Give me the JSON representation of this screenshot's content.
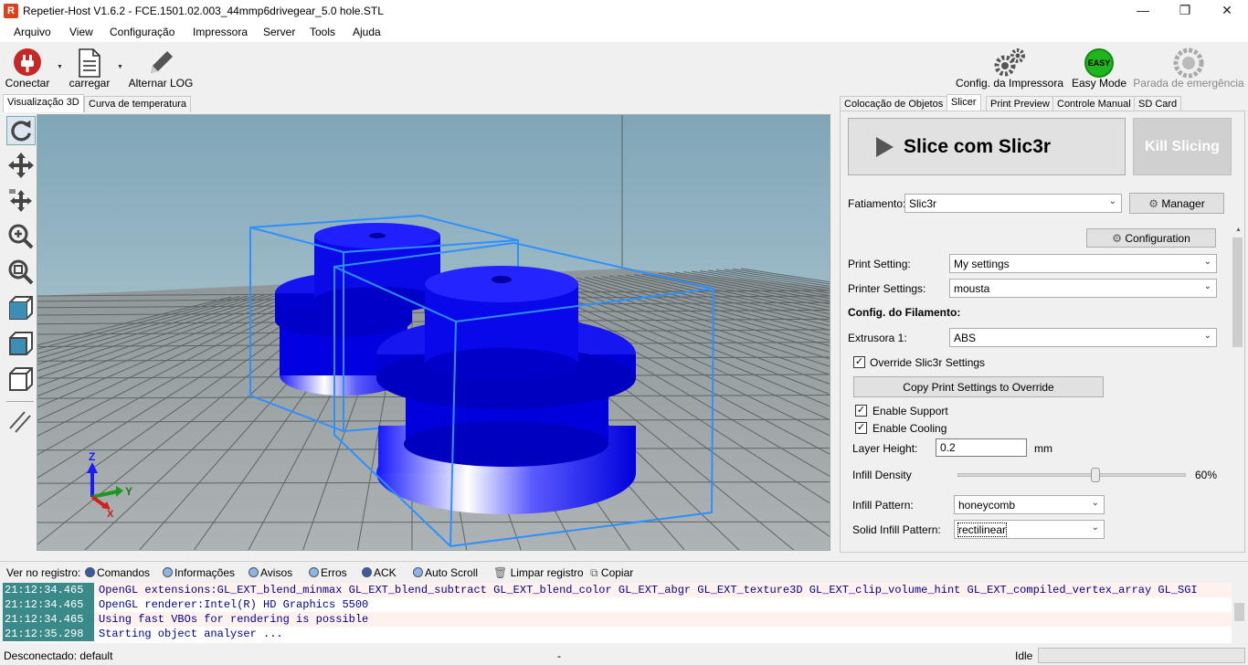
{
  "window": {
    "app_icon": "R",
    "title": "Repetier-Host V1.6.2 - FCE.1501.02.003_44mmp6drivegear_5.0 hole.STL",
    "minimize": "—",
    "maximize": "❐",
    "close": "✕"
  },
  "menu": [
    "Arquivo",
    "View",
    "Configuração",
    "Impressora",
    "Server",
    "Tools",
    "Ajuda"
  ],
  "toolbar": {
    "connect": "Conectar",
    "load": "carregar",
    "toggle_log": "Alternar LOG",
    "printer_config": "Config. da Impressora",
    "easy_mode": "Easy Mode",
    "easy_badge": "EASY",
    "emergency_stop": "Parada de emergência"
  },
  "left_tabs": [
    "Visualização 3D",
    "Curva de temperatura"
  ],
  "axes": {
    "z": "Z",
    "y": "Y",
    "x": "X"
  },
  "right_tabs": [
    "Colocação de Objetos",
    "Slicer",
    "Print Preview",
    "Controle Manual",
    "SD Card"
  ],
  "slicer": {
    "slice_button": "Slice com Slic3r",
    "kill_button": "Kill Slicing",
    "slicer_label": "Fatiamento:",
    "slicer_value": "Slic3r",
    "manager_button": "Manager",
    "configuration_button": "Configuration",
    "print_setting_label": "Print Setting:",
    "print_setting_value": "My settings",
    "printer_settings_label": "Printer Settings:",
    "printer_settings_value": "mousta",
    "filament_header": "Config. do Filamento:",
    "extruder_label": "Extrusora 1:",
    "extruder_value": "ABS",
    "override_label": "Override Slic3r Settings",
    "copy_button": "Copy Print Settings to Override",
    "support_label": "Enable Support",
    "cooling_label": "Enable Cooling",
    "layer_height_label": "Layer Height:",
    "layer_height_value": "0.2",
    "layer_height_unit": "mm",
    "infill_density_label": "Infill Density",
    "infill_density_value": "60%",
    "infill_density_fraction": 0.6,
    "infill_pattern_label": "Infill Pattern:",
    "infill_pattern_value": "honeycomb",
    "solid_infill_label": "Solid Infill Pattern:",
    "solid_infill_value": "rectilinear"
  },
  "log_filters": {
    "label": "Ver no registro:",
    "commands": "Comandos",
    "info": "Informações",
    "warnings": "Avisos",
    "errors": "Erros",
    "ack": "ACK",
    "autoscroll": "Auto Scroll",
    "clear": "Limpar registro",
    "copy": "Copiar"
  },
  "log": [
    {
      "time": "21:12:34.465",
      "text": "OpenGL extensions:GL_EXT_blend_minmax GL_EXT_blend_subtract GL_EXT_blend_color GL_EXT_abgr GL_EXT_texture3D GL_EXT_clip_volume_hint GL_EXT_compiled_vertex_array GL_SGI"
    },
    {
      "time": "21:12:34.465",
      "text": "OpenGL renderer:Intel(R) HD Graphics 5500"
    },
    {
      "time": "21:12:34.465",
      "text": "Using fast VBOs for rendering is possible"
    },
    {
      "time": "21:12:35.298",
      "text": "Starting object analyser ..."
    }
  ],
  "status": {
    "left": "Desconectado: default",
    "mid": "-",
    "right": "Idle"
  }
}
